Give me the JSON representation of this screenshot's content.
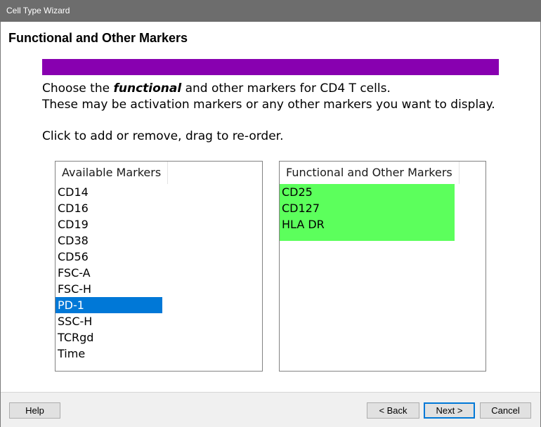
{
  "window": {
    "title": "Cell Type Wizard"
  },
  "page": {
    "title": "Functional and Other Markers"
  },
  "colors": {
    "accent_bar": "#8800b0",
    "selection": "#0078d7",
    "chosen_highlight": "#5cff5c"
  },
  "instructions": {
    "line1_prefix": "Choose the ",
    "line1_emphasis": "functional",
    "line1_suffix": " and other markers for CD4 T cells.",
    "line2": "These may be activation markers or any other markers you want to display.",
    "line3": "Click to add or remove, drag to re-order."
  },
  "available": {
    "header": "Available Markers",
    "items": [
      {
        "label": "CD14"
      },
      {
        "label": "CD16"
      },
      {
        "label": "CD19"
      },
      {
        "label": "CD38"
      },
      {
        "label": "CD56"
      },
      {
        "label": "FSC-A"
      },
      {
        "label": "FSC-H"
      },
      {
        "label": "PD-1",
        "selected": true
      },
      {
        "label": "SSC-H"
      },
      {
        "label": "TCRgd"
      },
      {
        "label": "Time"
      }
    ]
  },
  "chosen": {
    "header": "Functional and Other Markers",
    "items": [
      {
        "label": "CD25"
      },
      {
        "label": "CD127"
      },
      {
        "label": "HLA DR"
      }
    ]
  },
  "buttons": {
    "help": "Help",
    "back": "< Back",
    "next": "Next >",
    "cancel": "Cancel"
  }
}
